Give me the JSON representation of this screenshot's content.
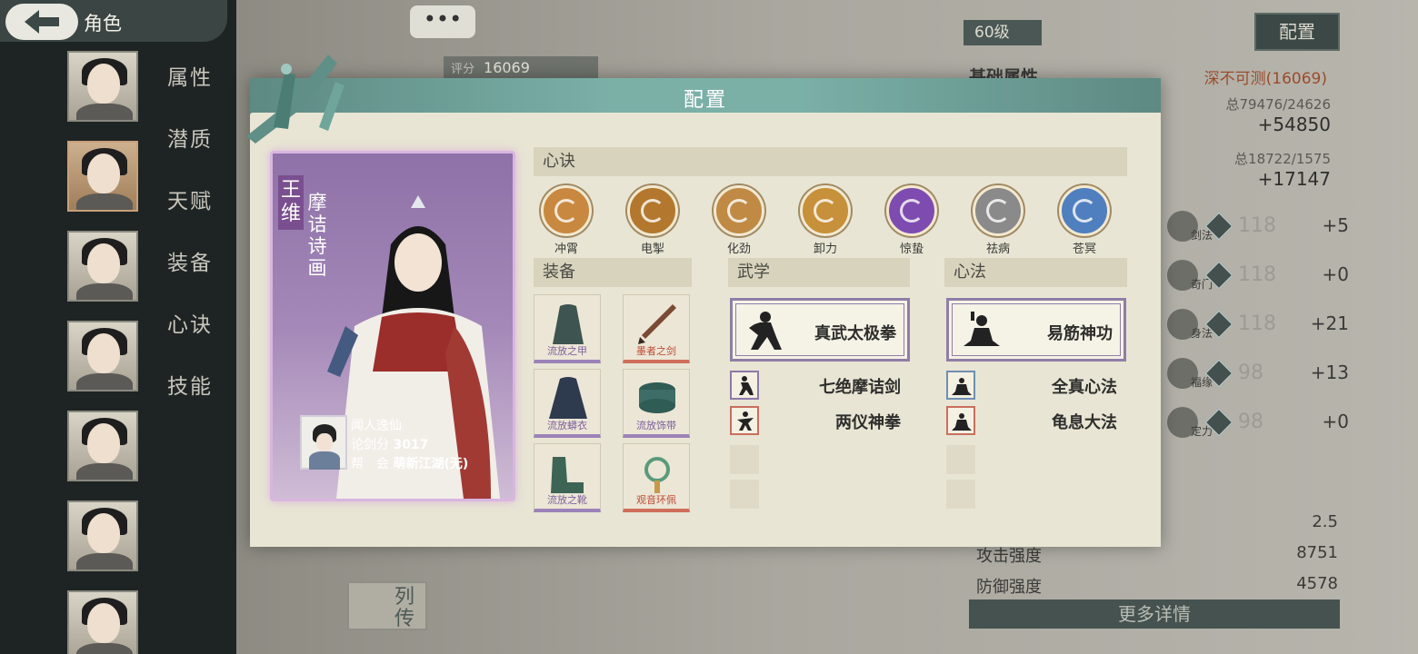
{
  "screen": {
    "title": "角色"
  },
  "menu": [
    "属性",
    "潜质",
    "天赋",
    "装备",
    "心诀",
    "技能"
  ],
  "top": {
    "chat": "•••",
    "score_label": "评分",
    "score_value": "16069"
  },
  "right_panel": {
    "level": "60级",
    "config_button": "配置",
    "base_title": "基础属性",
    "rank": "深不可测(16069)",
    "totals": [
      {
        "total": "总79476/24626",
        "delta": "+54850"
      },
      {
        "total": "总18722/1575",
        "delta": "+17147"
      }
    ],
    "attrs": [
      {
        "name": "剑法",
        "value": "118",
        "bonus": "+5"
      },
      {
        "name": "奇门",
        "value": "118",
        "bonus": "+0"
      },
      {
        "name": "身法",
        "value": "118",
        "bonus": "+21"
      },
      {
        "name": "福缘",
        "value": "98",
        "bonus": "+13"
      },
      {
        "name": "定力",
        "value": "98",
        "bonus": "+0"
      }
    ],
    "stats": [
      {
        "label": "",
        "value": "2.5"
      },
      {
        "label": "攻击强度",
        "value": "8751"
      },
      {
        "label": "防御强度",
        "value": "4578"
      }
    ],
    "more_button": "更多详情",
    "legend_button": "列传"
  },
  "modal": {
    "title": "配置",
    "hero": {
      "name": "王维",
      "title": "摩诘诗画",
      "player_name": "闻人逸仙",
      "sword_score_label": "论剑分",
      "sword_score": "3017",
      "guild_label": "帮　会",
      "guild": "萌新江湖(无)"
    },
    "xinjue_header": "心诀",
    "xinjue": [
      {
        "name": "冲霄",
        "color": "#c9883f"
      },
      {
        "name": "电掣",
        "color": "#b3782e"
      },
      {
        "name": "化劲",
        "color": "#c08a45"
      },
      {
        "name": "卸力",
        "color": "#c7903a"
      },
      {
        "name": "惊蛰",
        "color": "#7e4cb0"
      },
      {
        "name": "祛病",
        "color": "#8a8a8a"
      },
      {
        "name": "苍冥",
        "color": "#4f7fbf"
      }
    ],
    "equip_header": "装备",
    "equips": [
      {
        "name": "流放之甲",
        "rarity": "purple"
      },
      {
        "name": "墨者之剑",
        "rarity": "red"
      },
      {
        "name": "流放蟒衣",
        "rarity": "purple"
      },
      {
        "name": "流放饰带",
        "rarity": "purple"
      },
      {
        "name": "流放之靴",
        "rarity": "purple"
      },
      {
        "name": "观音环佩",
        "rarity": "red"
      }
    ],
    "wuxue_header": "武学",
    "wuxue_main": "真武太极拳",
    "wuxue_sub": [
      {
        "name": "七绝摩诘剑",
        "rarity": "purple"
      },
      {
        "name": "两仪神拳",
        "rarity": "red"
      }
    ],
    "xinfa_header": "心法",
    "xinfa_main": "易筋神功",
    "xinfa_sub": [
      {
        "name": "全真心法",
        "rarity": "blue"
      },
      {
        "name": "龟息大法",
        "rarity": "red"
      }
    ]
  }
}
